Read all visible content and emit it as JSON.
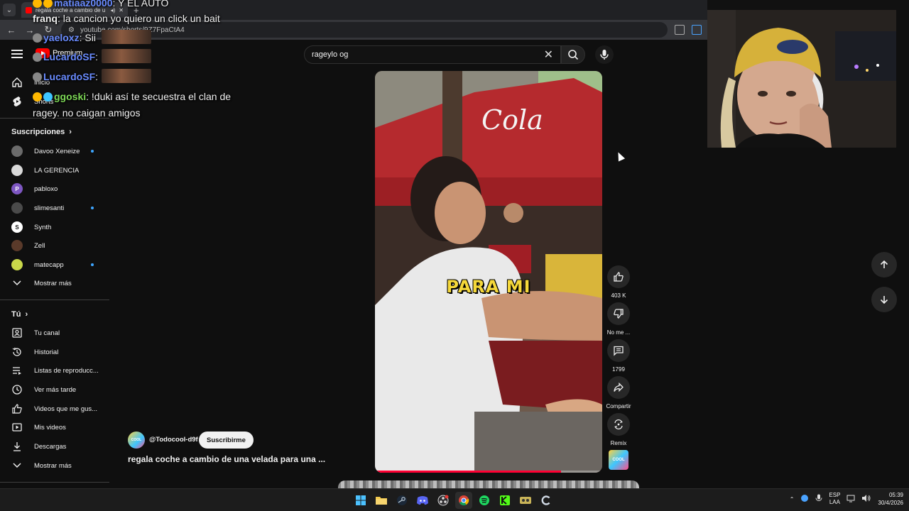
{
  "browser": {
    "tab_title": "regala coche a cambio de u",
    "url": "youtube.com/shorts/9Z7FpaCtA4"
  },
  "header": {
    "logo_text": "Premium",
    "search_query": "rageylo og"
  },
  "sidebar": {
    "top": [
      {
        "label": "Inicio",
        "icon": "home-icon"
      },
      {
        "label": "Shorts",
        "icon": "shorts-icon"
      }
    ],
    "subs_title": "Suscripciones",
    "subscriptions": [
      {
        "label": "Davoo Xeneize",
        "new": true,
        "color": "#6b6b6b",
        "letter": ""
      },
      {
        "label": "LA GERENCIA",
        "new": false,
        "color": "#d9d9d9",
        "letter": ""
      },
      {
        "label": "pabloxo",
        "new": false,
        "color": "#7e57c2",
        "letter": "P"
      },
      {
        "label": "slimesanti",
        "new": true,
        "color": "#4a4a4a",
        "letter": ""
      },
      {
        "label": "Synth",
        "new": false,
        "color": "#ffffff",
        "letter": "S"
      },
      {
        "label": "Zell",
        "new": false,
        "color": "#5a3a2a",
        "letter": ""
      },
      {
        "label": "matecapp",
        "new": true,
        "color": "#c9d84a",
        "letter": ""
      }
    ],
    "subs_more": "Mostrar más",
    "you_title": "Tú",
    "you": [
      {
        "label": "Tu canal",
        "icon": "channel-icon"
      },
      {
        "label": "Historial",
        "icon": "history-icon"
      },
      {
        "label": "Listas de reproducc...",
        "icon": "playlists-icon"
      },
      {
        "label": "Ver más tarde",
        "icon": "watch-later-icon"
      },
      {
        "label": "Videos que me gus...",
        "icon": "liked-icon"
      },
      {
        "label": "Mis videos",
        "icon": "my-videos-icon"
      },
      {
        "label": "Descargas",
        "icon": "downloads-icon"
      }
    ],
    "you_more": "Mostrar más"
  },
  "chat": [
    {
      "user": "matiaaz0000",
      "text": ": Y EL AUTO",
      "color": "#6a8cff"
    },
    {
      "user": "franq",
      "text": ": la cancion yo quiero un click un bait",
      "color": "#f1f1f1"
    },
    {
      "user": "yaeloxz",
      "text": ": Sii",
      "color": "#6a8cff"
    },
    {
      "user": "LucardoSF",
      "text": ":",
      "color": "#6a8cff"
    },
    {
      "user": "LucardoSF",
      "text": ":",
      "color": "#6a8cff"
    },
    {
      "user": "ggoski",
      "text": ": !duki así te secuestra el clan de",
      "color": "#7ed957"
    },
    {
      "user": "",
      "text": "ragey. no caigan amigos",
      "color": "#f1f1f1"
    }
  ],
  "video": {
    "caption": "PARA MI",
    "progress": 0.82,
    "channel": "@Todocool-d9f",
    "subscribe": "Suscribirme",
    "title": "regala coche a cambio de una velada para una ..."
  },
  "actions": {
    "likes": "403 K",
    "dislike": "No me ...",
    "comments": "1799",
    "share": "Compartir",
    "remix": "Remix"
  },
  "taskbar": {
    "lang_top": "ESP",
    "lang_bottom": "LAA",
    "time": "05:39",
    "date": "30/4/2026"
  },
  "colors": {
    "accent": "#ff0000",
    "new_dot": "#3ea6ff",
    "caption": "#f5d83a"
  }
}
